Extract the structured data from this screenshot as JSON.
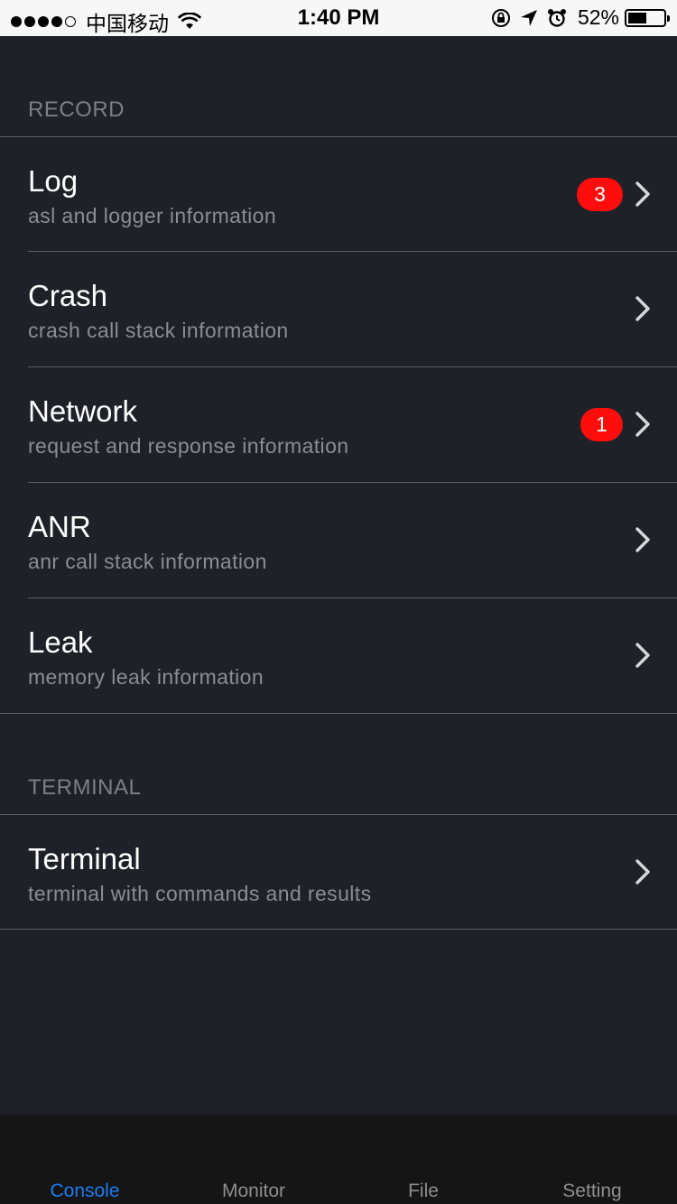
{
  "status_bar": {
    "carrier": "中国移动",
    "time": "1:40 PM",
    "battery_percent": "52%",
    "battery_level": 0.52,
    "signal_bars": 4,
    "signal_total": 5
  },
  "sections": {
    "record": {
      "header": "RECORD",
      "items": [
        {
          "title": "Log",
          "subtitle": "asl and logger information",
          "badge": "3"
        },
        {
          "title": "Crash",
          "subtitle": "crash call stack information",
          "badge": ""
        },
        {
          "title": "Network",
          "subtitle": "request and response information",
          "badge": "1"
        },
        {
          "title": "ANR",
          "subtitle": "anr call stack information",
          "badge": ""
        },
        {
          "title": "Leak",
          "subtitle": "memory leak information",
          "badge": ""
        }
      ]
    },
    "terminal": {
      "header": "TERMINAL",
      "items": [
        {
          "title": "Terminal",
          "subtitle": "terminal with commands and results",
          "badge": ""
        }
      ]
    }
  },
  "tab_bar": {
    "tabs": [
      {
        "label": "Console",
        "active": true
      },
      {
        "label": "Monitor",
        "active": false
      },
      {
        "label": "File",
        "active": false
      },
      {
        "label": "Setting",
        "active": false
      }
    ]
  },
  "colors": {
    "background": "#1f2129",
    "badge": "#ff0d0d",
    "active_tab": "#1b7cf0"
  }
}
